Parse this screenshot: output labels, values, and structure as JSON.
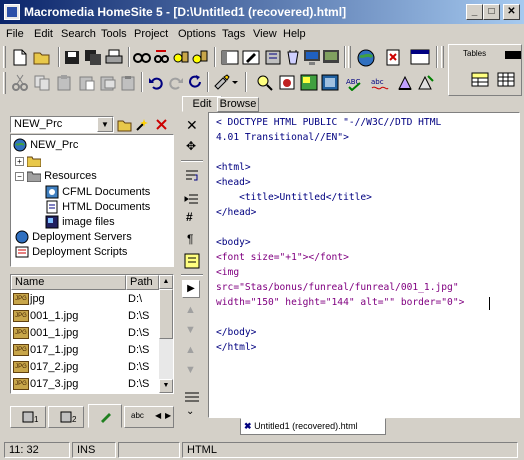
{
  "window": {
    "title": "Macromedia HomeSite 5 - [D:\\Untitled1 (recovered).html]",
    "minimize": "_",
    "maximize": "□",
    "close": "✕"
  },
  "menu": [
    "File",
    "Edit",
    "Search",
    "Tools",
    "Project",
    "Options",
    "Tags",
    "View",
    "Help"
  ],
  "tag_toolbar_label": "Tables",
  "left": {
    "project_select": "NEW_Prc",
    "tree": {
      "root": "NEW_Prc",
      "resources": "Resources",
      "cfml": "CFML Documents",
      "html": "HTML Documents",
      "images": "image files",
      "servers": "Deployment Servers",
      "scripts": "Deployment Scripts"
    },
    "list_headers": {
      "name": "Name",
      "path": "Path"
    },
    "files": [
      {
        "name": "jpg",
        "path": "D:\\"
      },
      {
        "name": "001_1.jpg",
        "path": "D:\\S"
      },
      {
        "name": "001_1.jpg",
        "path": "D:\\S"
      },
      {
        "name": "017_1.jpg",
        "path": "D:\\S"
      },
      {
        "name": "017_2.jpg",
        "path": "D:\\S"
      },
      {
        "name": "017_3.jpg",
        "path": "D:\\S"
      }
    ],
    "bottom_tabs": [
      "1",
      "2",
      "",
      "abc"
    ]
  },
  "editor": {
    "tabs": {
      "edit": "Edit",
      "browse": "Browse"
    },
    "lines": [
      {
        "text": "< DOCTYPE HTML PUBLIC \"-//W3C//DTD HTML",
        "cls": ""
      },
      {
        "text": "4.01 Transitional//EN\">",
        "cls": ""
      },
      {
        "text": "",
        "cls": ""
      },
      {
        "text": "<html>",
        "cls": ""
      },
      {
        "text": "<head>",
        "cls": ""
      },
      {
        "text": "    <title>Untitled</title>",
        "cls": ""
      },
      {
        "text": "</head>",
        "cls": ""
      },
      {
        "text": "",
        "cls": ""
      },
      {
        "text": "<body>",
        "cls": ""
      },
      {
        "text": "<font size=\"+1\"></font>",
        "cls": "purple"
      },
      {
        "text": "<img",
        "cls": "purple"
      },
      {
        "text": "src=\"Stas/bonus/funreal/funreal/001_1.jpg\"",
        "cls": "purple"
      },
      {
        "text": "width=\"150\" height=\"144\" alt=\"\" border=\"0\">",
        "cls": "purple"
      },
      {
        "text": "",
        "cls": ""
      },
      {
        "text": "</body>",
        "cls": ""
      },
      {
        "text": "</html>",
        "cls": ""
      }
    ],
    "doc_tab": "Untitled1 (recovered).html"
  },
  "status": {
    "position": "11: 32",
    "mode": "INS",
    "doc_type": "HTML"
  }
}
